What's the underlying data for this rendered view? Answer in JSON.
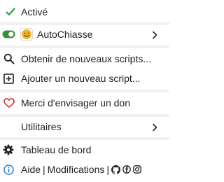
{
  "menu": {
    "enabled_label": "Activé",
    "script_name": "AutoChiasse",
    "script_enabled": true,
    "get_scripts_label": "Obtenir de nouveaux scripts...",
    "add_script_label": "Ajouter un nouveau script...",
    "donate_label": "Merci d'envisager un don",
    "utilities_label": "Utilitaires",
    "dashboard_label": "Tableau de bord",
    "help_label": "Aide",
    "separator_1": "|",
    "changelog_label": "Modifications",
    "separator_2": "|"
  },
  "icons": {
    "enabled": "check-icon",
    "toggle": "toggle-icon",
    "script": "smiley-icon",
    "get_scripts": "search-icon",
    "add_script": "plus-square-icon",
    "donate": "heart-icon",
    "dashboard": "gear-icon",
    "help": "info-icon",
    "github": "github-icon",
    "facebook": "facebook-icon",
    "instagram": "instagram-icon",
    "submenu": "chevron-right-icon"
  },
  "colors": {
    "check": "#2e9f47",
    "toggle_on": "#3a8f3a",
    "heart": "#d9383a",
    "info": "#1f7fd1",
    "smiley": "#f2b233",
    "separator": "#f1f1f1",
    "text": "#1f1f1f"
  }
}
